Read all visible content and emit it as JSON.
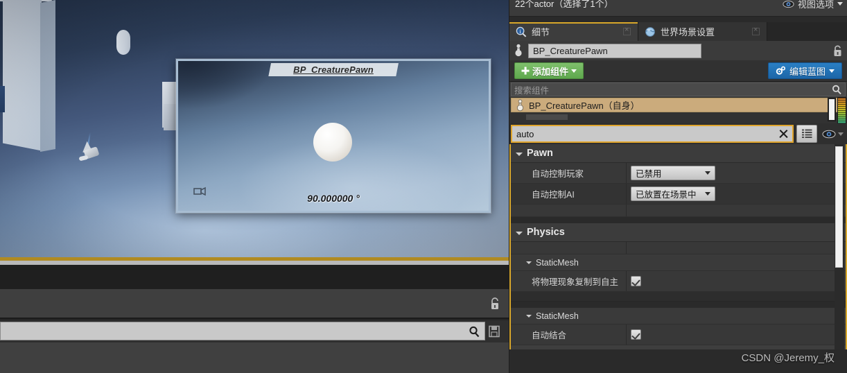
{
  "viewport": {
    "pip": {
      "actor_label": "BP_CreaturePawn",
      "angle_readout": "90.000000 °",
      "camera_icon": "camera-icon"
    },
    "scene_objects": [
      "white-pillar",
      "white-capsule",
      "camera-actor",
      "grey-blocks",
      "white-sphere"
    ]
  },
  "lower_left": {
    "search_placeholder": "",
    "lock_icon": "lock-icon",
    "search_icon": "search-icon",
    "save_icon": "save-icon"
  },
  "details": {
    "actor_count": "22个actor（选择了1个）",
    "view_options": {
      "label": "视图选项",
      "eye_icon": "eye-icon",
      "caret_icon": "chevron-down-icon"
    },
    "tabs": [
      {
        "label": "细节",
        "icon": "details-magnifier-icon",
        "active": true
      },
      {
        "label": "世界场景设置",
        "icon": "globe-icon",
        "active": false
      }
    ],
    "name_row": {
      "pawn_icon": "pawn-icon",
      "value": "BP_CreaturePawn",
      "placeholder": "BP_CreaturePawn",
      "lock_icon": "unlock-icon"
    },
    "buttons": {
      "add_component": {
        "label": "添加组件",
        "icon": "plus-icon",
        "caret": "chevron-down-icon"
      },
      "edit_blueprint": {
        "label": "编辑蓝图",
        "icon": "gears-icon",
        "caret": "chevron-down-icon"
      }
    },
    "component_search": {
      "placeholder": "搜索组件",
      "icon": "search-icon"
    },
    "component_tree": [
      {
        "label": "BP_CreaturePawn（自身）",
        "icon": "pawn-icon",
        "selected": true
      }
    ],
    "filter": {
      "value": "auto",
      "clear_icon": "close-icon",
      "grid_toggle_icon": "grid-view-icon",
      "eye_icon": "eye-icon",
      "eye_caret": "chevron-down-icon"
    },
    "sections": [
      {
        "id": "pawn",
        "title": "Pawn",
        "level": "category",
        "rows": [
          {
            "label": "自动控制玩家",
            "type": "combo",
            "value": "已禁用"
          },
          {
            "label": "自动控制AI",
            "type": "combo",
            "value": "已放置在场景中"
          }
        ]
      },
      {
        "id": "physics",
        "title": "Physics",
        "level": "category",
        "rows": []
      },
      {
        "id": "physics-staticmesh",
        "title": "StaticMesh",
        "level": "sub",
        "rows": [
          {
            "label": "将物理现象复制到自主",
            "type": "checkbox",
            "value": true
          }
        ]
      },
      {
        "id": "staticmesh",
        "title": "StaticMesh",
        "level": "sub",
        "rows": [
          {
            "label": "自动结合",
            "type": "checkbox",
            "value": true
          }
        ]
      }
    ],
    "collapse_icon": "collapse-up-icon",
    "scrollbar": "vertical-scrollbar"
  },
  "watermark": "CSDN @Jeremy_权",
  "colors": {
    "accent_yellow": "#d8a72a",
    "add_button_green": "#5ea84d",
    "edit_button_blue": "#1c66a8",
    "selection_tan": "#cbab7c",
    "panel_bg": "#343434"
  }
}
